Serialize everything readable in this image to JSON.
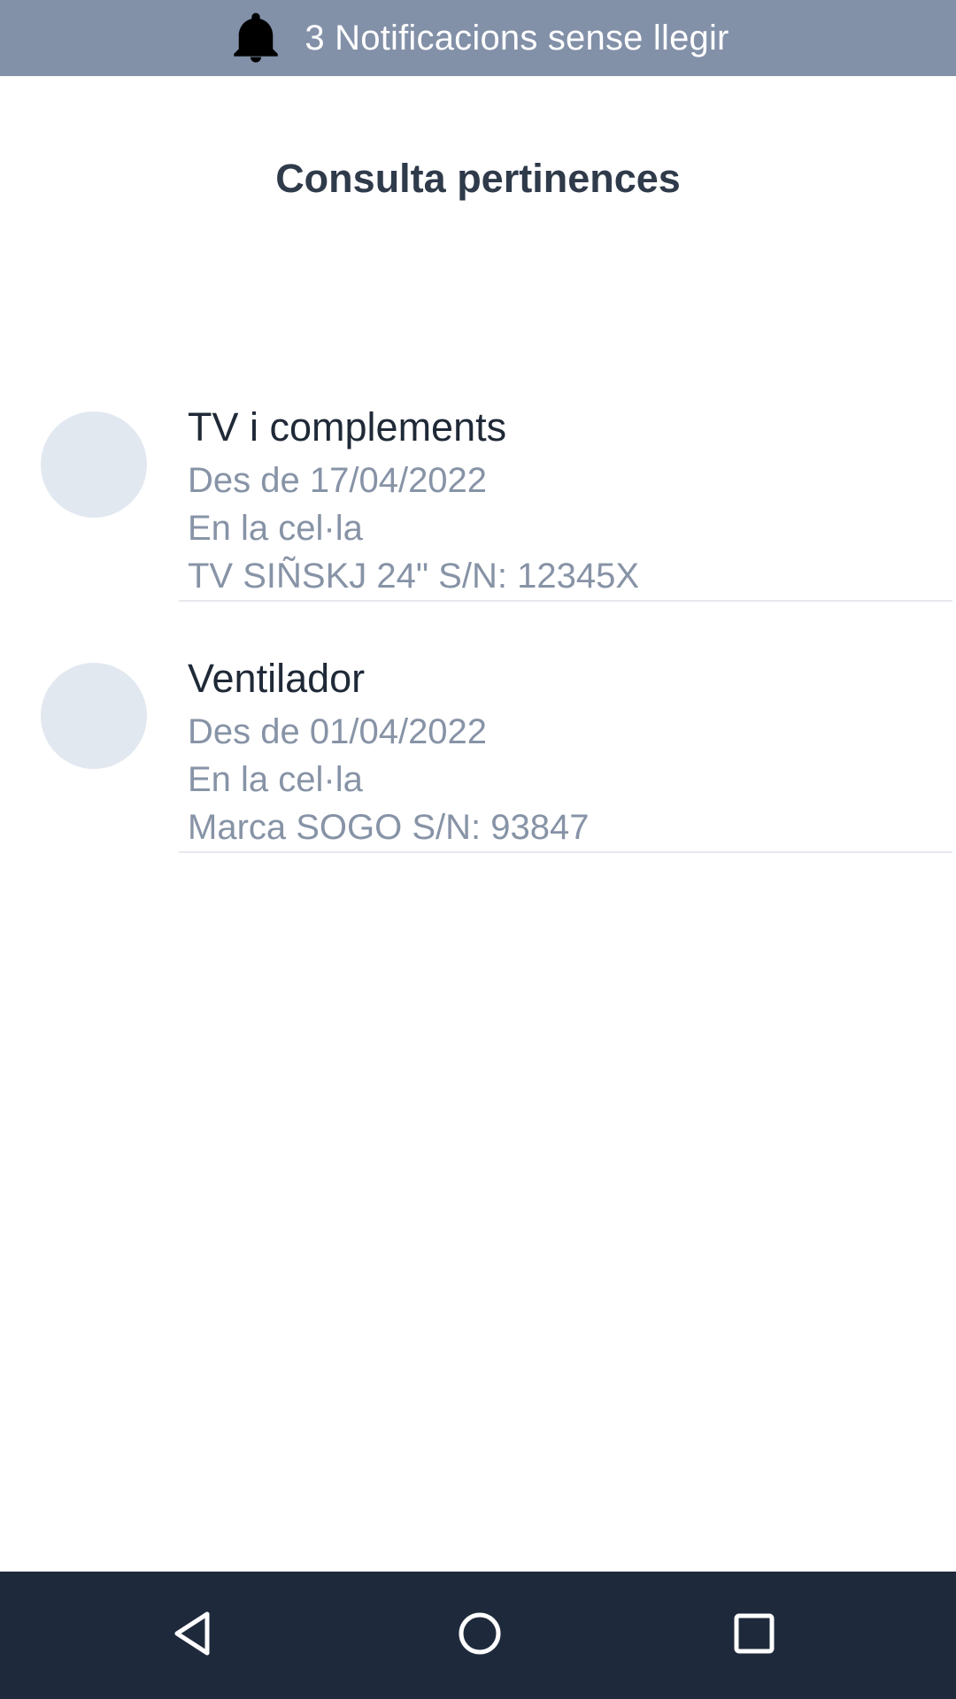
{
  "notification_bar": {
    "icon": "bell-icon",
    "text": "3 Notificacions sense llegir"
  },
  "page": {
    "title": "Consulta pertinences"
  },
  "items": [
    {
      "title": "TV i complements",
      "since": "Des de 17/04/2022",
      "location": "En la cel·la",
      "detail": "TV SIÑSKJ 24\" S/N: 12345X"
    },
    {
      "title": "Ventilador",
      "since": "Des de 01/04/2022",
      "location": "En la cel·la",
      "detail": "Marca SOGO S/N: 93847"
    }
  ],
  "navigation": {
    "icons": [
      "back-triangle-icon",
      "home-circle-icon",
      "recents-square-icon"
    ]
  },
  "colors": {
    "notification_bar": "#8290a8",
    "title_text": "#2f3a4a",
    "secondary_text": "#8793a6",
    "avatar_placeholder": "#e2e8f0",
    "nav_bar": "#1e2a3c"
  }
}
